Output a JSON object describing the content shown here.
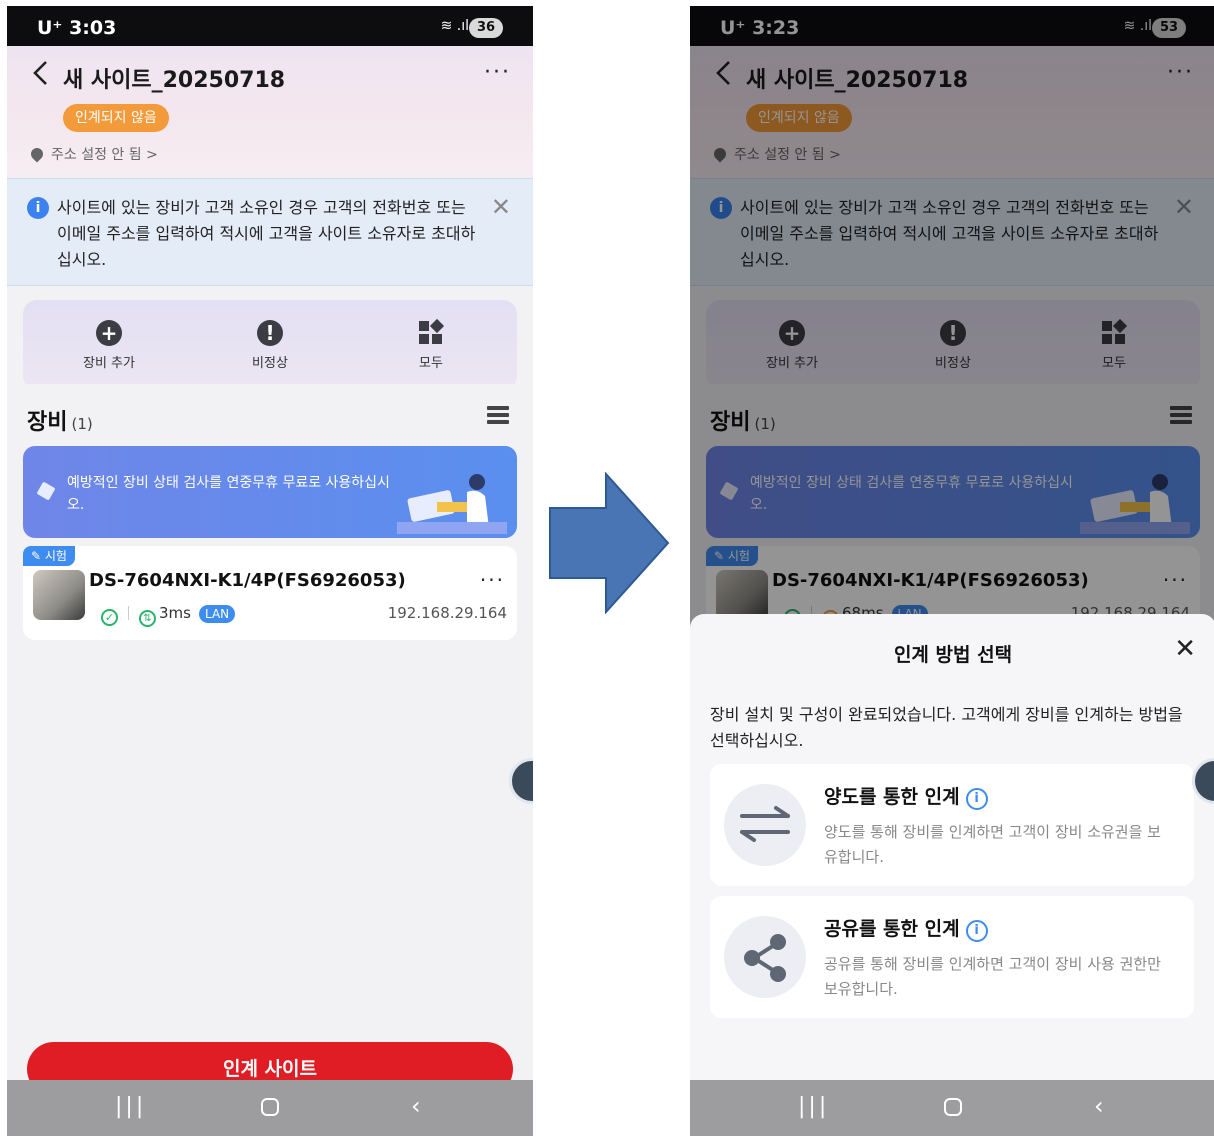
{
  "left": {
    "status": {
      "time": "U⁺ 3:03",
      "battery": "36"
    },
    "header": {
      "title": "새 사이트_20250718",
      "more": "···"
    },
    "badge": "인계되지 않음",
    "address": "주소 설정 안 됨 >",
    "notice": {
      "text": "사이트에 있는 장비가 고객 소유인 경우 고객의 전화번호 또는 이메일 주소를 입력하여 적시에 고객을 사이트 소유자로 초대하십시오.",
      "close": "✕"
    },
    "quick": [
      {
        "label": "장비 추가",
        "icon": "plus-circle-icon"
      },
      {
        "label": "비정상",
        "icon": "alert-circle-icon"
      },
      {
        "label": "모두",
        "icon": "grid-icon"
      }
    ],
    "section": {
      "title": "장비",
      "count": "(1)"
    },
    "promo": "예방적인 장비 상태 검사를 연중무휴 무료로 사용하십시오.",
    "device": {
      "trial": "시험",
      "name": "DS-7604NXI-K1/4P(FS6926053)",
      "latency": "3ms",
      "network": "LAN",
      "ip": "192.168.29.164",
      "more": "···"
    },
    "handover_button": "인계 사이트"
  },
  "right": {
    "status": {
      "time": "U⁺ 3:23",
      "battery": "53"
    },
    "header": {
      "title": "새 사이트_20250718",
      "more": "···"
    },
    "badge": "인계되지 않음",
    "address": "주소 설정 안 됨 >",
    "notice": {
      "text": "사이트에 있는 장비가 고객 소유인 경우 고객의 전화번호 또는 이메일 주소를 입력하여 적시에 고객을 사이트 소유자로 초대하십시오.",
      "close": "✕"
    },
    "quick": [
      {
        "label": "장비 추가",
        "icon": "plus-circle-icon"
      },
      {
        "label": "비정상",
        "icon": "alert-circle-icon"
      },
      {
        "label": "모두",
        "icon": "grid-icon"
      }
    ],
    "section": {
      "title": "장비",
      "count": "(1)"
    },
    "promo": "예방적인 장비 상태 검사를 연중무휴 무료로 사용하십시오.",
    "device": {
      "trial": "시험",
      "name": "DS-7604NXI-K1/4P(FS6926053)",
      "latency": "68ms",
      "network": "LAN",
      "ip": "192.168.29.164",
      "more": "···"
    },
    "sheet": {
      "title": "인계 방법 선택",
      "close": "✕",
      "description": "장비 설치 및 구성이 완료되었습니다. 고객에게 장비를 인계하는 방법을 선택하십시오.",
      "options": [
        {
          "title": "양도를 통한 인계",
          "info": "i",
          "description": "양도를 통해 장비를 인계하면 고객이 장비 소유권을 보유합니다.",
          "icon": "transfer-arrows-icon"
        },
        {
          "title": "공유를 통한 인계",
          "info": "i",
          "description": "공유를 통해 장비를 인계하면 고객이 장비 사용 권한만 보유합니다.",
          "icon": "share-icon"
        }
      ]
    }
  },
  "colors": {
    "accent_red": "#e01d24",
    "badge_orange": "#f39a3a",
    "blue": "#3e8cf0",
    "arrow_blue": "#4a75b4"
  }
}
